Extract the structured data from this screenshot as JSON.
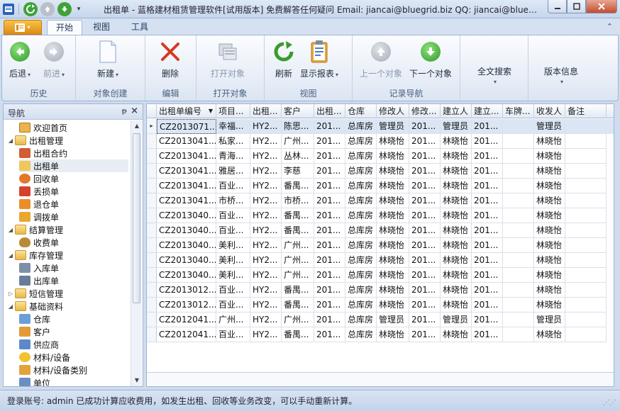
{
  "window": {
    "title": "出租单 - 蓝格建材租赁管理软件[试用版本] 免费解答任何疑问 Email: jiancai@bluegrid.biz QQ: jiancai@bluegrid.biz"
  },
  "tabs": [
    {
      "label": "开始",
      "active": true
    },
    {
      "label": "视图",
      "active": false
    },
    {
      "label": "工具",
      "active": false
    }
  ],
  "ribbon": {
    "groups": {
      "history": "历史",
      "create": "对象创建",
      "edit": "编辑",
      "open": "打开对象",
      "view": "视图",
      "record_nav": "记录导航"
    },
    "buttons": {
      "back": "后退",
      "forward": "前进",
      "new": "新建",
      "delete": "删除",
      "open_object": "打开对象",
      "refresh": "刷新",
      "show_report": "显示报表",
      "prev_object": "上一个对象",
      "next_object": "下一个对象",
      "fulltext_search": "全文搜索",
      "version_info": "版本信息"
    }
  },
  "nav": {
    "title": "导航",
    "items": [
      {
        "label": "欢迎首页",
        "level": 1,
        "icon": "home-icon"
      },
      {
        "label": "出租管理",
        "level": 0,
        "icon": "folder-icon",
        "expanded": true
      },
      {
        "label": "出租合约",
        "level": 1,
        "icon": "contract-icon"
      },
      {
        "label": "出租单",
        "level": 1,
        "icon": "rental-order-icon",
        "selected": true
      },
      {
        "label": "回收单",
        "level": 1,
        "icon": "recycle-icon"
      },
      {
        "label": "丢损单",
        "level": 1,
        "icon": "loss-icon"
      },
      {
        "label": "退仓单",
        "level": 1,
        "icon": "return-icon"
      },
      {
        "label": "调拨单",
        "level": 1,
        "icon": "transfer-icon"
      },
      {
        "label": "结算管理",
        "level": 0,
        "icon": "folder-icon",
        "expanded": true
      },
      {
        "label": "收费单",
        "level": 1,
        "icon": "money-bag-icon"
      },
      {
        "label": "库存管理",
        "level": 0,
        "icon": "folder-icon",
        "expanded": true
      },
      {
        "label": "入库单",
        "level": 1,
        "icon": "stock-in-icon"
      },
      {
        "label": "出库单",
        "level": 1,
        "icon": "stock-out-icon"
      },
      {
        "label": "短信管理",
        "level": 0,
        "icon": "folder-icon",
        "expanded": false
      },
      {
        "label": "基础资料",
        "level": 0,
        "icon": "folder-icon",
        "expanded": true
      },
      {
        "label": "仓库",
        "level": 1,
        "icon": "warehouse-icon"
      },
      {
        "label": "客户",
        "level": 1,
        "icon": "customer-icon"
      },
      {
        "label": "供应商",
        "level": 1,
        "icon": "supplier-icon"
      },
      {
        "label": "材料/设备",
        "level": 1,
        "icon": "material-icon"
      },
      {
        "label": "材料/设备类别",
        "level": 1,
        "icon": "category-icon"
      },
      {
        "label": "单位",
        "level": 1,
        "icon": "unit-icon"
      }
    ]
  },
  "grid": {
    "columns": [
      "出租单编号",
      "项目...",
      "出租...",
      "客户",
      "出租...",
      "仓库",
      "修改人",
      "修改...",
      "建立人",
      "建立...",
      "车牌...",
      "收发人",
      "备注"
    ],
    "rows": [
      [
        "CZ2013071...",
        "幸福...",
        "HY2...",
        "陈思...",
        "201...",
        "总库房",
        "管理员",
        "201...",
        "管理员",
        "201...",
        "",
        "管理员",
        ""
      ],
      [
        "CZ2013041...",
        "私家...",
        "HY2...",
        "广州...",
        "201...",
        "总库房",
        "林晓怡",
        "201...",
        "林晓怡",
        "201...",
        "",
        "林晓怡",
        ""
      ],
      [
        "CZ2013041...",
        "青海...",
        "HY2...",
        "丛林...",
        "201...",
        "总库房",
        "林晓怡",
        "201...",
        "林晓怡",
        "201...",
        "",
        "林晓怡",
        ""
      ],
      [
        "CZ2013041...",
        "雅居...",
        "HY2...",
        "李慈",
        "201...",
        "总库房",
        "林晓怡",
        "201...",
        "林晓怡",
        "201...",
        "",
        "林晓怡",
        ""
      ],
      [
        "CZ2013041...",
        "百业...",
        "HY2...",
        "番禺...",
        "201...",
        "总库房",
        "林晓怡",
        "201...",
        "林晓怡",
        "201...",
        "",
        "林晓怡",
        ""
      ],
      [
        "CZ2013041...",
        "市桥...",
        "HY2...",
        "市桥...",
        "201...",
        "总库房",
        "林晓怡",
        "201...",
        "林晓怡",
        "201...",
        "",
        "林晓怡",
        ""
      ],
      [
        "CZ2013040...",
        "百业...",
        "HY2...",
        "番禺...",
        "201...",
        "总库房",
        "林晓怡",
        "201...",
        "林晓怡",
        "201...",
        "",
        "林晓怡",
        ""
      ],
      [
        "CZ2013040...",
        "百业...",
        "HY2...",
        "番禺...",
        "201...",
        "总库房",
        "林晓怡",
        "201...",
        "林晓怡",
        "201...",
        "",
        "林晓怡",
        ""
      ],
      [
        "CZ2013040...",
        "美利...",
        "HY2...",
        "广州...",
        "201...",
        "总库房",
        "林晓怡",
        "201...",
        "林晓怡",
        "201...",
        "",
        "林晓怡",
        ""
      ],
      [
        "CZ2013040...",
        "美利...",
        "HY2...",
        "广州...",
        "201...",
        "总库房",
        "林晓怡",
        "201...",
        "林晓怡",
        "201...",
        "",
        "林晓怡",
        ""
      ],
      [
        "CZ2013040...",
        "美利...",
        "HY2...",
        "广州...",
        "201...",
        "总库房",
        "林晓怡",
        "201...",
        "林晓怡",
        "201...",
        "",
        "林晓怡",
        ""
      ],
      [
        "CZ2013012...",
        "百业...",
        "HY2...",
        "番禺...",
        "201...",
        "总库房",
        "林晓怡",
        "201...",
        "林晓怡",
        "201...",
        "",
        "林晓怡",
        ""
      ],
      [
        "CZ2013012...",
        "百业...",
        "HY2...",
        "番禺...",
        "201...",
        "总库房",
        "林晓怡",
        "201...",
        "林晓怡",
        "201...",
        "",
        "林晓怡",
        ""
      ],
      [
        "CZ2012041...",
        "广州...",
        "HY2...",
        "广州...",
        "201...",
        "总库房",
        "管理员",
        "201...",
        "管理员",
        "201...",
        "",
        "管理员",
        ""
      ],
      [
        "CZ2012041...",
        "百业...",
        "HY2...",
        "番禺...",
        "201...",
        "总库房",
        "林晓怡",
        "201...",
        "林晓怡",
        "201...",
        "",
        "林晓怡",
        ""
      ]
    ]
  },
  "status": {
    "text": "登录账号: admin    已成功计算应收费用，如发生出租、回收等业务改变，可以手动重新计算。"
  }
}
